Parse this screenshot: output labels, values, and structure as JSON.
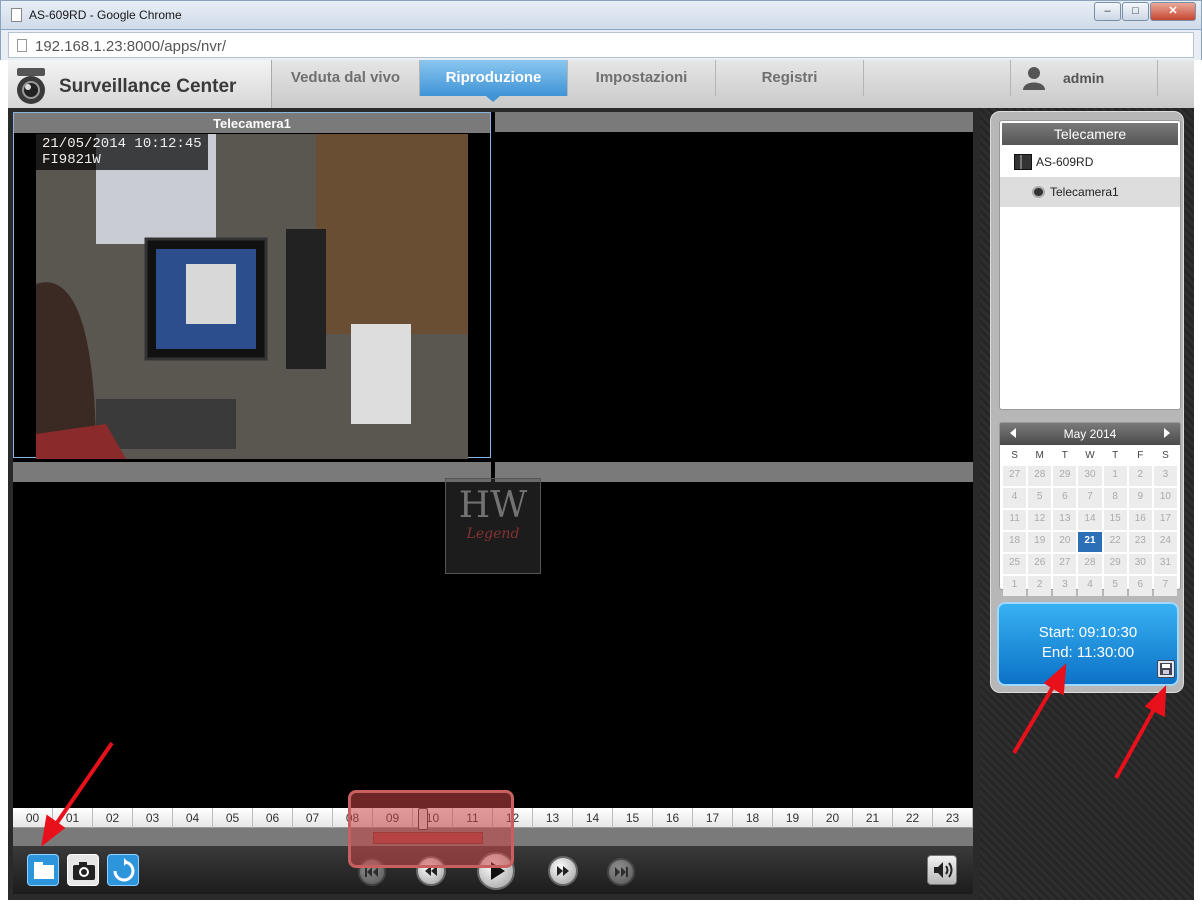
{
  "window": {
    "title": "AS-609RD - Google Chrome",
    "min_label": "–",
    "max_label": "□",
    "close_label": "✕"
  },
  "address_bar": {
    "url": "192.168.1.23:8000/apps/nvr/"
  },
  "header": {
    "brand": "Surveillance Center",
    "tabs": [
      {
        "label": "Veduta dal vivo",
        "active": false
      },
      {
        "label": "Riproduzione",
        "active": true
      },
      {
        "label": "Impostazioni",
        "active": false
      },
      {
        "label": "Registri",
        "active": false
      }
    ],
    "user": "admin"
  },
  "video": {
    "cell1_title": "Telecamera1",
    "timestamp": "21/05/2014 10:12:45",
    "camera_id": "FI9821W",
    "watermark_top": "HW",
    "watermark_bottom": "Legend"
  },
  "timeline": {
    "hours": [
      "00",
      "01",
      "02",
      "03",
      "04",
      "05",
      "06",
      "07",
      "08",
      "09",
      "10",
      "11",
      "12",
      "13",
      "14",
      "15",
      "16",
      "17",
      "18",
      "19",
      "20",
      "21",
      "22",
      "23"
    ]
  },
  "sidebar": {
    "tree_title": "Telecamere",
    "nvr_name": "AS-609RD",
    "camera_name": "Telecamera1"
  },
  "calendar": {
    "month_label": "May 2014",
    "dow": [
      "S",
      "M",
      "T",
      "W",
      "T",
      "F",
      "S"
    ],
    "days": [
      "27",
      "28",
      "29",
      "30",
      "1",
      "2",
      "3",
      "4",
      "5",
      "6",
      "7",
      "8",
      "9",
      "10",
      "11",
      "12",
      "13",
      "14",
      "15",
      "16",
      "17",
      "18",
      "19",
      "20",
      "21",
      "22",
      "23",
      "24",
      "25",
      "26",
      "27",
      "28",
      "29",
      "30",
      "31",
      "1",
      "2",
      "3",
      "4",
      "5",
      "6",
      "7"
    ],
    "selected_day": "21"
  },
  "time_range": {
    "start": "Start: 09:10:30",
    "end": "End: 11:30:00"
  },
  "colors": {
    "accent": "#3f94d6",
    "annotation": "#e8101a"
  },
  "icons": {
    "open_folder": "folder-video-icon",
    "snapshot": "camera-icon",
    "refresh": "refresh-icon",
    "volume": "volume-icon",
    "save": "save-icon"
  }
}
